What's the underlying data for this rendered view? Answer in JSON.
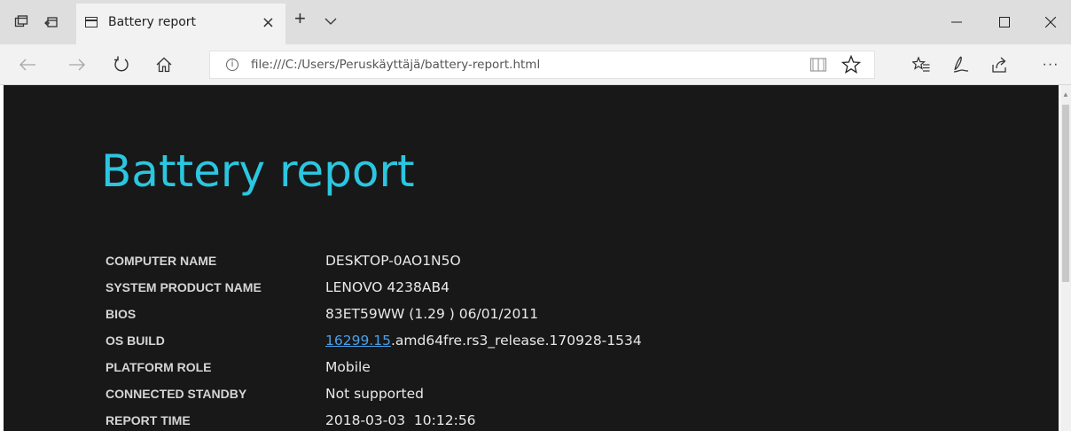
{
  "tab": {
    "title": "Battery report",
    "close_glyph": "×",
    "new_tab_glyph": "+",
    "tab_list_icon": "chevron-down-icon"
  },
  "window_controls": [
    "minimize-icon",
    "maximize-icon",
    "close-icon"
  ],
  "nav": {
    "url": "file:///C:/Users/Peruskäyttäjä/battery-report.html",
    "icons": [
      "back-arrow-icon",
      "forward-arrow-icon",
      "refresh-icon",
      "home-icon",
      "info-icon",
      "reading-view-icon",
      "favorite-star-icon",
      "favorites-hub-icon",
      "web-note-pen-icon",
      "share-icon",
      "more-dots-icon"
    ],
    "more_glyph": "···"
  },
  "report": {
    "title": "Battery report",
    "rows": [
      {
        "label": "COMPUTER NAME",
        "value": "DESKTOP-0AO1N5O"
      },
      {
        "label": "SYSTEM PRODUCT NAME",
        "value": "LENOVO 4238AB4"
      },
      {
        "label": "BIOS",
        "value": "83ET59WW (1.29 ) 06/01/2011"
      },
      {
        "label": "OS BUILD",
        "value_link": "16299.15",
        "value_rest": ".amd64fre.rs3_release.170928-1534"
      },
      {
        "label": "PLATFORM ROLE",
        "value": "Mobile"
      },
      {
        "label": "CONNECTED STANDBY",
        "value": "Not supported"
      },
      {
        "label": "REPORT TIME",
        "value": "2018-03-03  10:12:56"
      }
    ]
  },
  "colors": {
    "title_accent": "#2bc6e0",
    "page_background": "#181818",
    "link": "#4aa0e8",
    "chrome": "#dedede"
  }
}
